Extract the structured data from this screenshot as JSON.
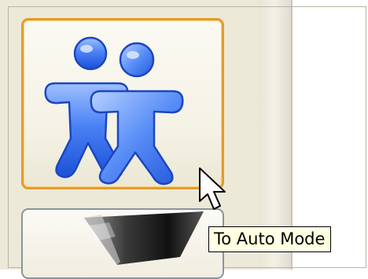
{
  "toolbar": {
    "people_button": {
      "icon": "people-icon",
      "accent_color": "#e59b29"
    },
    "download_button": {
      "icon": "funnel-icon"
    }
  },
  "tooltip": {
    "text": "To Auto Mode"
  },
  "cursor": {
    "icon": "arrow-cursor-icon"
  },
  "colors": {
    "icon_blue": "#2f6cf0",
    "hover_border": "#e59b29",
    "tooltip_bg": "#ffffe1",
    "panel_bg": "#ece9d8"
  }
}
